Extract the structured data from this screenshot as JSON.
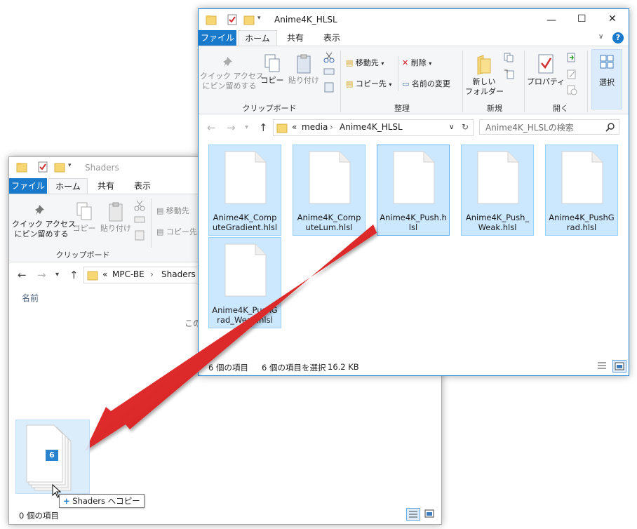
{
  "back_window": {
    "title": "Shaders",
    "tabs": {
      "file": "ファイル",
      "home": "ホーム",
      "share": "共有",
      "view": "表示"
    },
    "ribbon": {
      "pin_quick_access": "クイック アクセス\nにピン留めする",
      "copy": "コピー",
      "paste": "貼り付け",
      "move_to": "移動先",
      "copy_to": "コピー先",
      "group_clipboard": "クリップボード"
    },
    "path": {
      "overflow": "«",
      "parts": [
        "MPC-BE",
        "Shaders"
      ]
    },
    "column_name": "名前",
    "empty_partial": "この",
    "status_items": "0 個の項目"
  },
  "front_window": {
    "title": "Anime4K_HLSL",
    "tabs": {
      "file": "ファイル",
      "home": "ホーム",
      "share": "共有",
      "view": "表示"
    },
    "ribbon": {
      "pin_quick_access": "クイック アクセス\nにピン留めする",
      "copy": "コピー",
      "paste": "貼り付け",
      "move_to": "移動先",
      "copy_to": "コピー先",
      "delete": "削除",
      "rename": "名前の変更",
      "new_folder": "新しい\nフォルダー",
      "properties": "プロパティ",
      "select": "選択",
      "group_clipboard": "クリップボード",
      "group_organize": "整理",
      "group_new": "新規",
      "group_open": "開く"
    },
    "path": {
      "overflow": "«",
      "parts": [
        "media",
        "Anime4K_HLSL"
      ]
    },
    "search_placeholder": "Anime4K_HLSLの検索",
    "files": [
      {
        "name": "Anime4K_ComputeGradient.hlsl"
      },
      {
        "name": "Anime4K_ComputeLum.hlsl"
      },
      {
        "name": "Anime4K_Push.hlsl"
      },
      {
        "name": "Anime4K_Push_Weak.hlsl"
      },
      {
        "name": "Anime4K_PushGrad.hlsl"
      },
      {
        "name": "Anime4K_PushGrad_Weak.hlsl"
      }
    ],
    "status_items": "6 個の項目",
    "status_selected": "6 個の項目を選択",
    "status_size": "16.2 KB"
  },
  "drag": {
    "count_badge": "6",
    "tooltip_plus": "+",
    "tooltip_text": "Shaders へコピー"
  },
  "colors": {
    "accent": "#1979ca",
    "selection": "#cce8ff",
    "selection_border": "#99d1ff",
    "arrow": "#e02020"
  }
}
